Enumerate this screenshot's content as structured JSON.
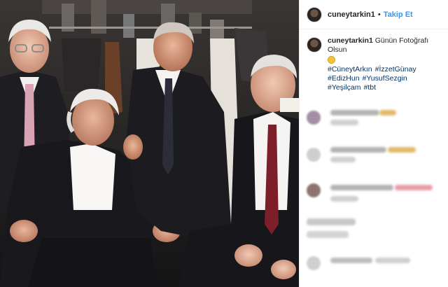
{
  "header": {
    "username": "cuneytarkin1",
    "separator": "•",
    "follow_label": "Takip Et"
  },
  "caption": {
    "username": "cuneytarkin1",
    "text": "Günün Fotoğrafı Olsun",
    "emoji_icon": "ok-hand-emoji-icon",
    "hashtags": [
      "#CüneytArkın",
      "#İzzetGünay",
      "#EdizHun",
      "#YusufSezgin",
      "#Yeşilçam",
      "#tbt"
    ]
  },
  "photo": {
    "description_icon": "group-photo",
    "background_color": "#1b1a1c"
  },
  "colors": {
    "link": "#3897f0",
    "hashtag": "#003569",
    "text": "#262626",
    "divider": "#efefef"
  }
}
